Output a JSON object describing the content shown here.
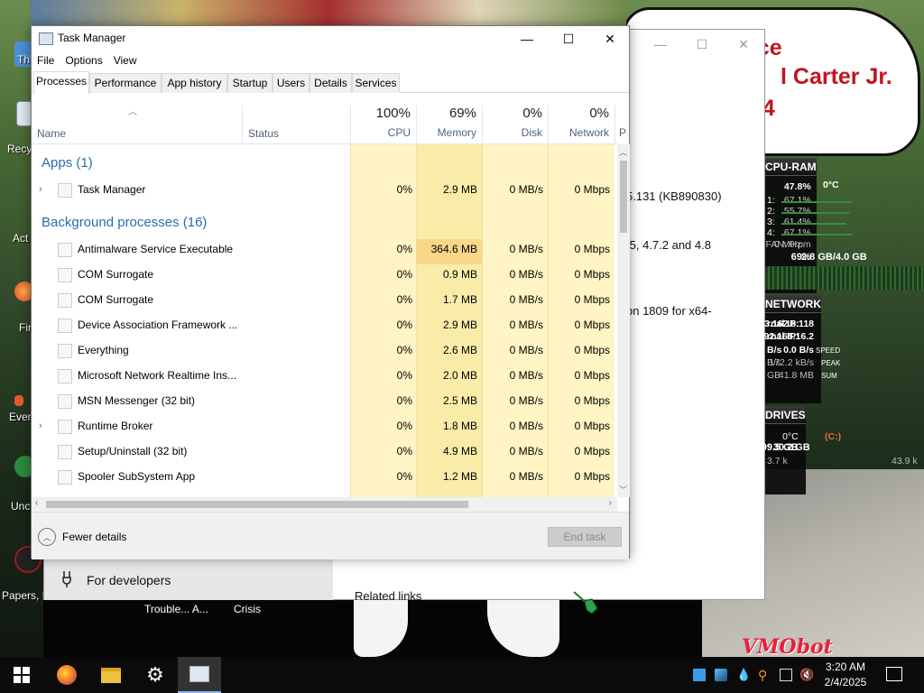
{
  "desktop": {
    "icons": [
      {
        "label": "Thi"
      },
      {
        "label": "Recy"
      },
      {
        "label": "Act"
      },
      {
        "label": "Fir"
      },
      {
        "label": "Ever"
      },
      {
        "label": "Unc"
      },
      {
        "label": "Papers, P"
      }
    ],
    "sign_lines": [
      "ace",
      "l Carter Jr.",
      "24"
    ],
    "watermark": "VMObot",
    "bg_labels": [
      "Trouble... A...",
      "Crisis"
    ]
  },
  "settings_window": {
    "lines": [
      "5.131 (KB890830)",
      ".5, 4.7.2 and 4.8",
      "on 1809 for x64-"
    ],
    "for_developers": "For developers",
    "related_links": "Related links"
  },
  "widgets": {
    "cpu_ram": {
      "title": "CPU-RAM",
      "temp": "0°C",
      "total": "47.8%",
      "cores": [
        {
          "label": "1:",
          "value": "67.1%"
        },
        {
          "label": "2:",
          "value": "55.7%"
        },
        {
          "label": "3:",
          "value": "61.4%"
        },
        {
          "label": "4:",
          "value": "67.1%"
        }
      ],
      "freq": "0 MHz",
      "fan": "FAN: 0rpm",
      "ram": "2.8 GB/4.0 GB",
      "ram_pct": "69%"
    },
    "network": {
      "title": "NETWORK",
      "rows": [
        {
          "left": "rnal IP:",
          "right": "23.162.8.118"
        },
        {
          "left": "rnal IP:",
          "right": "192.168.16.2"
        },
        {
          "left": "B/s",
          "mid": "SPEED",
          "right": "0.0 B/s"
        },
        {
          "left": "B/s",
          "mid": "PEAK",
          "right": "172.2 kB/s"
        },
        {
          "left": "GB",
          "mid": "SUM",
          "right": "41.8 MB"
        }
      ]
    },
    "drives": {
      "title": "DRIVES",
      "temp": "0°C",
      "drive": "(C:)",
      "free": ": 30.2 GB",
      "total": "Total: 99.5 GB",
      "read": "3.7 k",
      "write": "43.9 k"
    }
  },
  "task_manager": {
    "title": "Task Manager",
    "controls": {
      "minimize": "—",
      "maximize": "☐",
      "close": "✕"
    },
    "menu": [
      "File",
      "Options",
      "View"
    ],
    "tabs": [
      "Processes",
      "Performance",
      "App history",
      "Startup",
      "Users",
      "Details",
      "Services"
    ],
    "active_tab": "Processes",
    "columns": {
      "name": "Name",
      "status": "Status",
      "cpu": {
        "pct": "100%",
        "label": "CPU"
      },
      "memory": {
        "pct": "69%",
        "label": "Memory"
      },
      "disk": {
        "pct": "0%",
        "label": "Disk"
      },
      "network": {
        "pct": "0%",
        "label": "Network"
      },
      "overflow": "P"
    },
    "groups": {
      "apps": "Apps (1)",
      "background": "Background processes (16)"
    },
    "apps": [
      {
        "name": "Task Manager",
        "cpu": "0%",
        "memory": "2.9 MB",
        "disk": "0 MB/s",
        "network": "0 Mbps",
        "expandable": true
      }
    ],
    "background": [
      {
        "name": "Antimalware Service Executable",
        "cpu": "0%",
        "memory": "364.6 MB",
        "disk": "0 MB/s",
        "network": "0 Mbps",
        "expandable": false
      },
      {
        "name": "COM Surrogate",
        "cpu": "0%",
        "memory": "0.9 MB",
        "disk": "0 MB/s",
        "network": "0 Mbps",
        "expandable": false
      },
      {
        "name": "COM Surrogate",
        "cpu": "0%",
        "memory": "1.7 MB",
        "disk": "0 MB/s",
        "network": "0 Mbps",
        "expandable": false
      },
      {
        "name": "Device Association Framework ...",
        "cpu": "0%",
        "memory": "2.9 MB",
        "disk": "0 MB/s",
        "network": "0 Mbps",
        "expandable": false
      },
      {
        "name": "Everything",
        "cpu": "0%",
        "memory": "2.6 MB",
        "disk": "0 MB/s",
        "network": "0 Mbps",
        "expandable": false
      },
      {
        "name": "Microsoft Network Realtime Ins...",
        "cpu": "0%",
        "memory": "2.0 MB",
        "disk": "0 MB/s",
        "network": "0 Mbps",
        "expandable": false
      },
      {
        "name": "MSN Messenger (32 bit)",
        "cpu": "0%",
        "memory": "2.5 MB",
        "disk": "0 MB/s",
        "network": "0 Mbps",
        "expandable": false
      },
      {
        "name": "Runtime Broker",
        "cpu": "0%",
        "memory": "1.8 MB",
        "disk": "0 MB/s",
        "network": "0 Mbps",
        "expandable": true
      },
      {
        "name": "Setup/Uninstall (32 bit)",
        "cpu": "0%",
        "memory": "4.9 MB",
        "disk": "0 MB/s",
        "network": "0 Mbps",
        "expandable": false
      },
      {
        "name": "Spooler SubSystem App",
        "cpu": "0%",
        "memory": "1.2 MB",
        "disk": "0 MB/s",
        "network": "0 Mbps",
        "expandable": false
      }
    ],
    "fewer_details": "Fewer details",
    "end_task": "End task"
  },
  "taskbar": {
    "apps": [
      "start-icon",
      "firefox-icon",
      "file-explorer-icon",
      "settings-icon",
      "task-manager-icon"
    ],
    "clock": {
      "time": "3:20 AM",
      "date": "2/4/2025"
    }
  },
  "colors": {
    "highlight_light": "#fff4c4",
    "highlight_mid": "#f9eca8",
    "highlight_strong": "#f8d68a",
    "group_blue": "#2b6cb0"
  }
}
